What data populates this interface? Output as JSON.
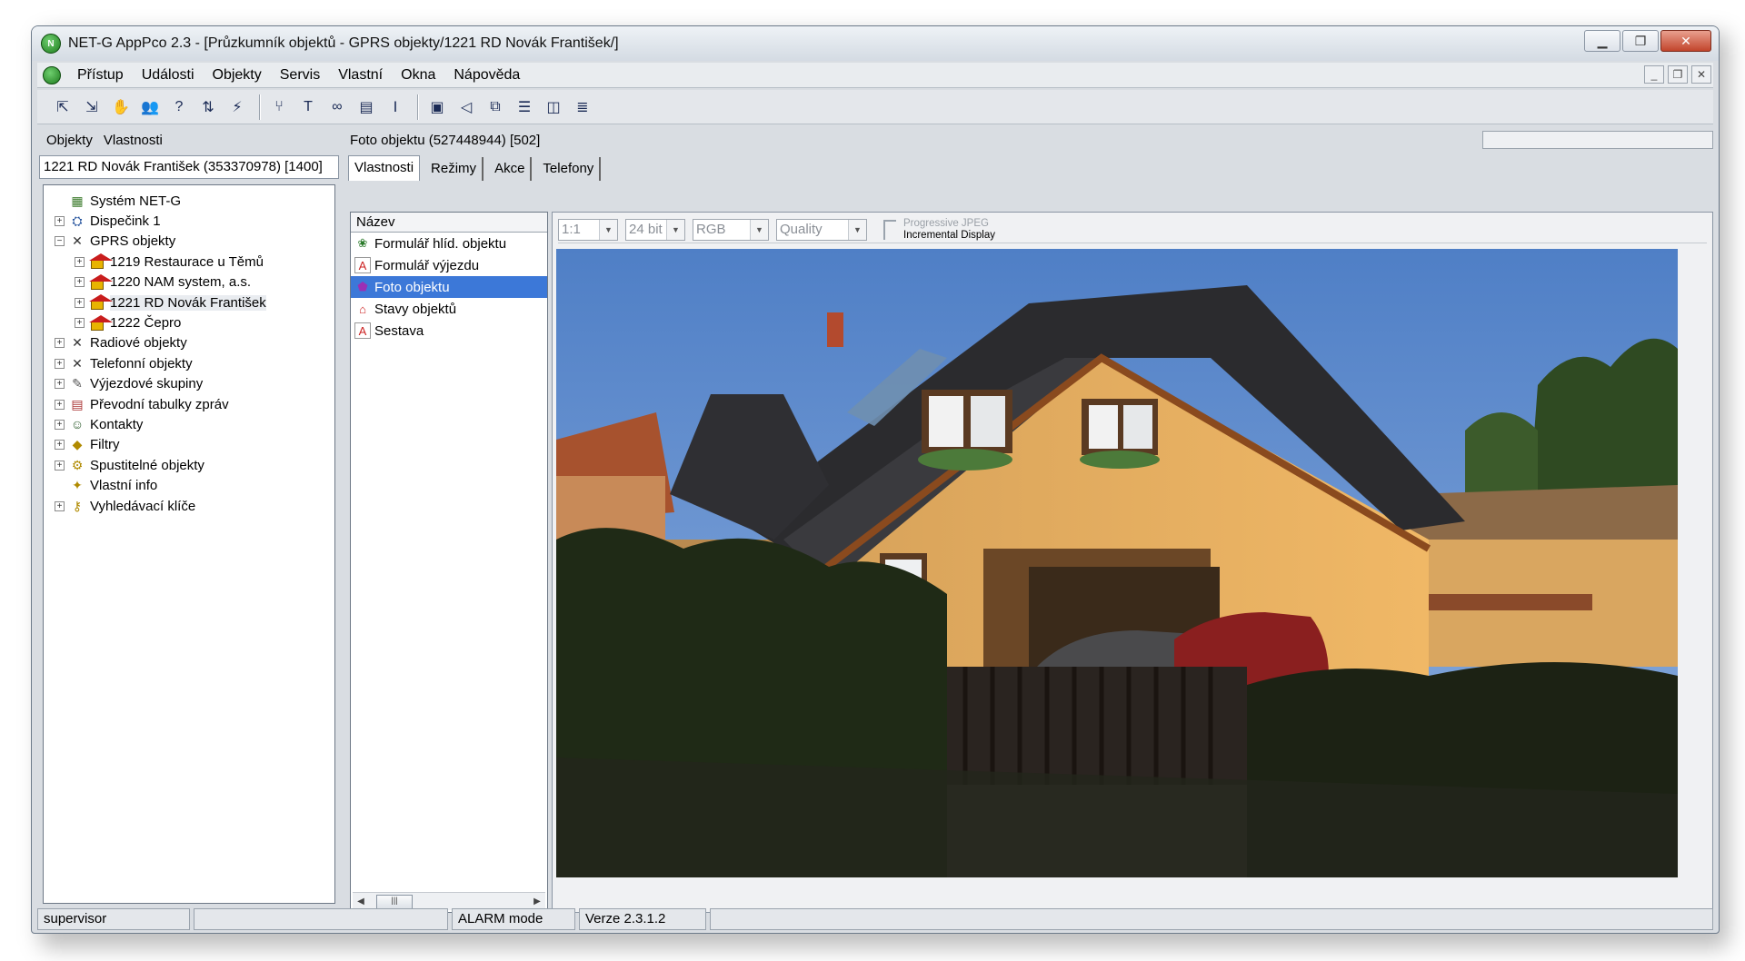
{
  "window": {
    "title": "NET-G AppPco 2.3 - [Průzkumník objektů - GPRS objekty/1221 RD Novák František/]"
  },
  "menu": {
    "items": [
      "Přístup",
      "Události",
      "Objekty",
      "Servis",
      "Vlastní",
      "Okna",
      "Nápověda"
    ]
  },
  "toolbar": {
    "icons": [
      "login-icon",
      "logout-icon",
      "hand-icon",
      "people-icon",
      "help-icon",
      "arrows-icon",
      "signal-icon",
      "tree-icon",
      "text-icon",
      "binoculars-icon",
      "document-icon",
      "cursor-icon",
      "objects-icon",
      "speaker-icon",
      "windows-icon",
      "split-horizontal-icon",
      "split-vertical-icon",
      "list-icon"
    ]
  },
  "left": {
    "header": {
      "objects": "Objekty",
      "properties": "Vlastnosti"
    },
    "selected": "1221 RD Novák František  (353370978) [1400]",
    "tree": [
      {
        "label": "Systém NET-G",
        "level": 0,
        "expander": "",
        "icon": "system-icon"
      },
      {
        "label": "Dispečink 1",
        "level": 0,
        "expander": "+",
        "icon": "dispatch-icon"
      },
      {
        "label": "GPRS objekty",
        "level": 0,
        "expander": "−",
        "icon": "gprs-icon"
      },
      {
        "label": "1219 Restaurace u Těmů",
        "level": 1,
        "expander": "+",
        "icon": "house-icon"
      },
      {
        "label": "1220 NAM system, a.s.",
        "level": 1,
        "expander": "+",
        "icon": "house-icon"
      },
      {
        "label": "1221 RD Novák František",
        "level": 1,
        "expander": "+",
        "icon": "house-icon"
      },
      {
        "label": "1222 Čepro",
        "level": 1,
        "expander": "+",
        "icon": "house-icon"
      },
      {
        "label": "Radiové objekty",
        "level": 0,
        "expander": "+",
        "icon": "radio-icon"
      },
      {
        "label": "Telefonní objekty",
        "level": 0,
        "expander": "+",
        "icon": "phone-icon"
      },
      {
        "label": "Výjezdové skupiny",
        "level": 0,
        "expander": "+",
        "icon": "group-icon"
      },
      {
        "label": "Převodní tabulky zpráv",
        "level": 0,
        "expander": "+",
        "icon": "table-icon"
      },
      {
        "label": "Kontakty",
        "level": 0,
        "expander": "+",
        "icon": "contacts-icon"
      },
      {
        "label": "Filtry",
        "level": 0,
        "expander": "+",
        "icon": "filter-icon"
      },
      {
        "label": "Spustitelné objekty",
        "level": 0,
        "expander": "+",
        "icon": "executable-icon"
      },
      {
        "label": "Vlastní info",
        "level": 0,
        "expander": "",
        "icon": "info-icon"
      },
      {
        "label": "Vyhledávací klíče",
        "level": 0,
        "expander": "+",
        "icon": "keys-icon"
      }
    ]
  },
  "main": {
    "header": "Foto objektu  (527448944) [502]",
    "tabs": [
      "Vlastnosti",
      "Režimy",
      "Akce",
      "Telefony"
    ],
    "list": {
      "column": "Název",
      "items": [
        {
          "label": "Formulář hlíd. objektu",
          "icon": "form-guard-icon",
          "selected": false
        },
        {
          "label": "Formulář výjezdu",
          "icon": "form-icon",
          "selected": false
        },
        {
          "label": "Foto objektu",
          "icon": "photo-icon",
          "selected": true
        },
        {
          "label": "Stavy objektů",
          "icon": "states-icon",
          "selected": false
        },
        {
          "label": "Sestava",
          "icon": "report-icon",
          "selected": false
        }
      ]
    },
    "image_toolbar": {
      "zoom": "1:1",
      "bits": "24 bit",
      "color": "RGB",
      "quality": "Quality",
      "progressive": "Progressive JPEG",
      "incremental": "Incremental Display"
    }
  },
  "status": {
    "user": "supervisor",
    "mode": "ALARM mode",
    "version": "Verze 2.3.1.2"
  },
  "colors": {
    "selection": "#3c78d8",
    "window_bg": "#d9dde2"
  }
}
